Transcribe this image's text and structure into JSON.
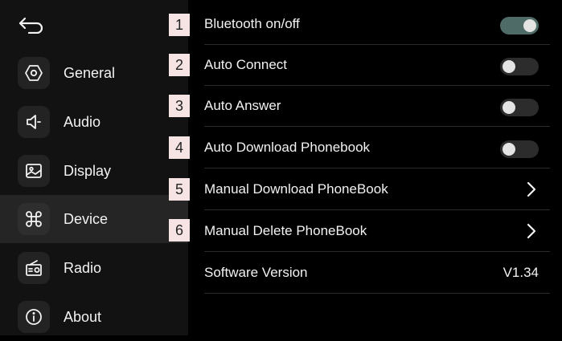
{
  "sidebar": {
    "back_icon": "back-arrow-icon",
    "items": [
      {
        "label": "General",
        "icon": "hexagon-settings-icon"
      },
      {
        "label": "Audio",
        "icon": "speaker-icon"
      },
      {
        "label": "Display",
        "icon": "image-icon"
      },
      {
        "label": "Device",
        "icon": "command-key-icon"
      },
      {
        "label": "Radio",
        "icon": "radio-icon"
      },
      {
        "label": "About",
        "icon": "info-icon"
      }
    ],
    "active": "Device"
  },
  "settings": [
    {
      "badge": "1",
      "label": "Bluetooth on/off",
      "control": "toggle",
      "on": true
    },
    {
      "badge": "2",
      "label": "Auto Connect",
      "control": "toggle",
      "on": false
    },
    {
      "badge": "3",
      "label": "Auto Answer",
      "control": "toggle",
      "on": false
    },
    {
      "badge": "4",
      "label": "Auto Download Phonebook",
      "control": "toggle",
      "on": false
    },
    {
      "badge": "5",
      "label": "Manual Download PhoneBook",
      "control": "chevron"
    },
    {
      "badge": "6",
      "label": "Manual Delete PhoneBook",
      "control": "chevron"
    },
    {
      "label": "Software Version",
      "control": "value",
      "value": "V1.34"
    }
  ],
  "colors": {
    "sidebar_bg": "#121212",
    "active_item_bg": "#252525",
    "toggle_on": "#4f6b68",
    "toggle_off": "#2c2c2c",
    "badge_bg": "#f6e3e3"
  }
}
